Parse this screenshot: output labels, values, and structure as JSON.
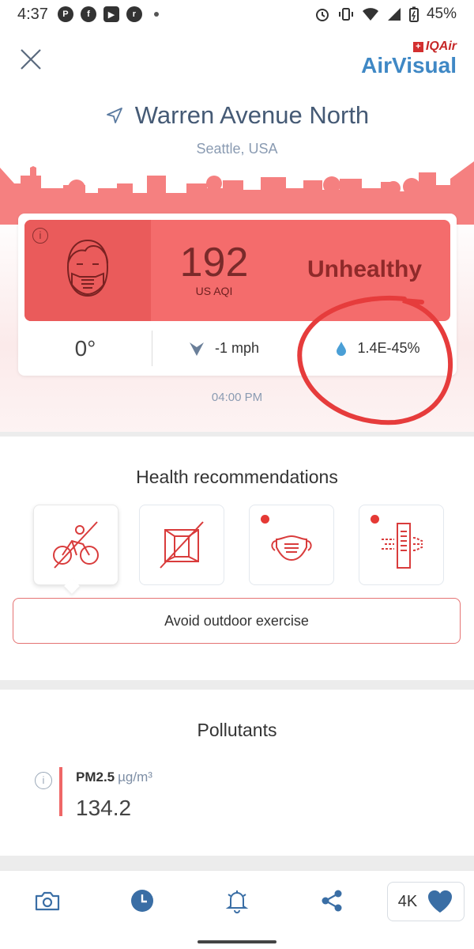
{
  "status_bar": {
    "time": "4:37",
    "app_icons": [
      "P",
      "f",
      "▶",
      "r"
    ],
    "battery": "45%"
  },
  "header": {
    "brand_top": "IQAir",
    "brand_main": "AirVisual",
    "location_name": "Warren Avenue North",
    "location_city": "Seattle, USA"
  },
  "aqi": {
    "value": "192",
    "unit": "US AQI",
    "status": "Unhealthy",
    "color": "#f46c6c"
  },
  "weather": {
    "temperature": "0°",
    "wind": "-1 mph",
    "humidity": "1.4E-45%"
  },
  "timestamp": "04:00 PM",
  "health": {
    "title": "Health recommendations",
    "icons": [
      "no-cycling-icon",
      "closed-window-icon",
      "face-mask-icon",
      "air-purifier-icon"
    ],
    "recommendation": "Avoid outdoor exercise"
  },
  "pollutants": {
    "title": "Pollutants",
    "items": [
      {
        "name": "PM2.5",
        "unit": "µg/m³",
        "value": "134.2"
      }
    ]
  },
  "bottom_nav": {
    "favorites_count": "4K"
  }
}
